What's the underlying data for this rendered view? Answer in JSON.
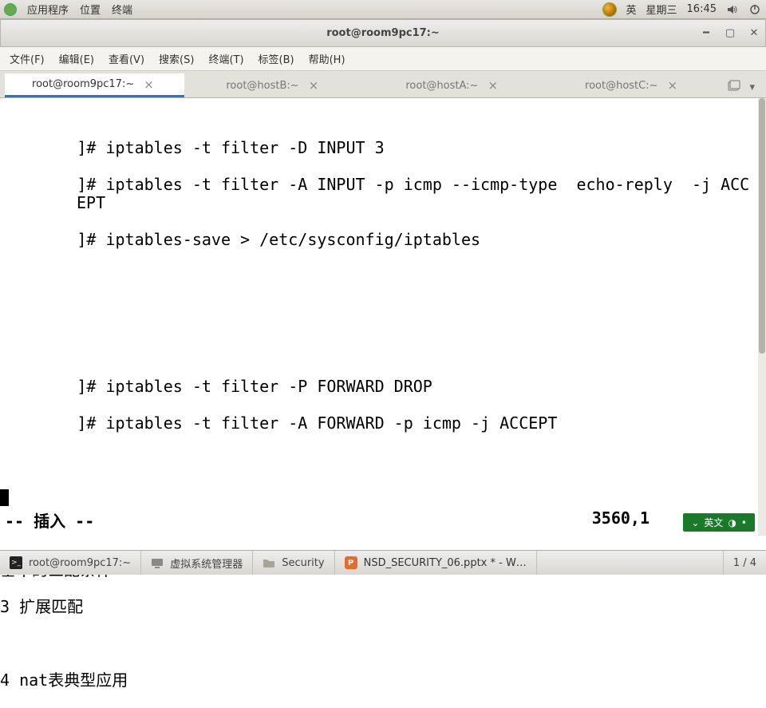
{
  "top_panel": {
    "apps": "应用程序",
    "places": "位置",
    "terminal": "终端",
    "ime": "英",
    "day": "星期三",
    "time": "16:45"
  },
  "window": {
    "title": "root@room9pc17:~"
  },
  "menubar": {
    "file": "文件(F)",
    "edit": "编辑(E)",
    "view": "查看(V)",
    "search": "搜索(S)",
    "terminal": "终端(T)",
    "tabs": "标签(B)",
    "help": "帮助(H)"
  },
  "tabs": [
    {
      "label": "root@room9pc17:~",
      "active": true
    },
    {
      "label": "root@hostB:~",
      "active": false
    },
    {
      "label": "root@hostA:~",
      "active": false
    },
    {
      "label": "root@hostC:~",
      "active": false
    }
  ],
  "terminal_lines": {
    "l1": "        ]# iptables -t filter -D INPUT 3",
    "l2": "        ]# iptables -t filter -A INPUT -p icmp --icmp-type  echo-reply  -j ACCEPT",
    "l3": "        ]# iptables-save > /etc/sysconfig/iptables",
    "l4": "        ]# iptables -t filter -P FORWARD DROP",
    "l5": "        ]# iptables -t filter -A FORWARD -p icmp -j ACCEPT",
    "b1": "基本的匹配条件",
    "b2": "3 扩展匹配",
    "b3": "4 nat表典型应用"
  },
  "vim_status": {
    "mode": "-- 插入 --",
    "position": "3560,1",
    "ime_label": "英文"
  },
  "taskbar": {
    "t1": "root@room9pc17:~",
    "t2": "虚拟系统管理器",
    "t3": "Security",
    "t4": "NSD_SECURITY_06.pptx * - W…",
    "pager": "1 / 4"
  }
}
